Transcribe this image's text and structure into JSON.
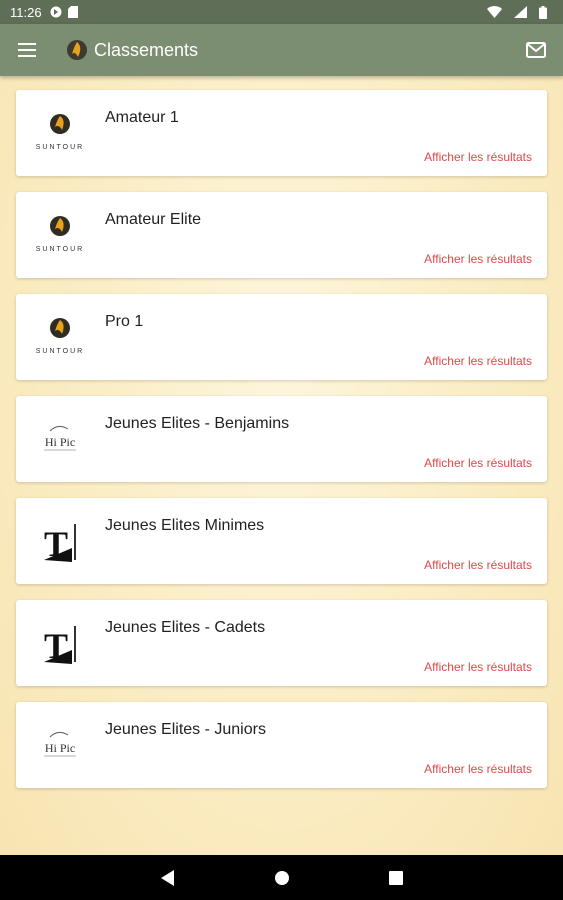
{
  "status": {
    "time": "11:26"
  },
  "app_bar": {
    "title": "Classements"
  },
  "cards": [
    {
      "name": "Amateur 1",
      "logo": "suntour-logo",
      "logo_text": "SUNTOUR",
      "link": "Afficher les résultats"
    },
    {
      "name": "Amateur Elite",
      "logo": "suntour-logo",
      "logo_text": "SUNTOUR",
      "link": "Afficher les résultats"
    },
    {
      "name": "Pro 1",
      "logo": "suntour-logo",
      "logo_text": "SUNTOUR",
      "link": "Afficher les résultats"
    },
    {
      "name": "Jeunes Elites - Benjamins",
      "logo": "hipic-logo",
      "logo_text": "Hi Pic",
      "link": "Afficher les résultats"
    },
    {
      "name": "Jeunes Elites Minimes",
      "logo": "t-logo",
      "logo_text": "T",
      "link": "Afficher les résultats"
    },
    {
      "name": "Jeunes Elites - Cadets",
      "logo": "t-logo",
      "logo_text": "T",
      "link": "Afficher les résultats"
    },
    {
      "name": "Jeunes Elites - Juniors",
      "logo": "hipic-logo",
      "logo_text": "Hi Pic",
      "link": "Afficher les résultats"
    }
  ],
  "colors": {
    "app_bar": "#7b8e72",
    "status_bar": "#5f6e56",
    "link": "#e04848"
  }
}
